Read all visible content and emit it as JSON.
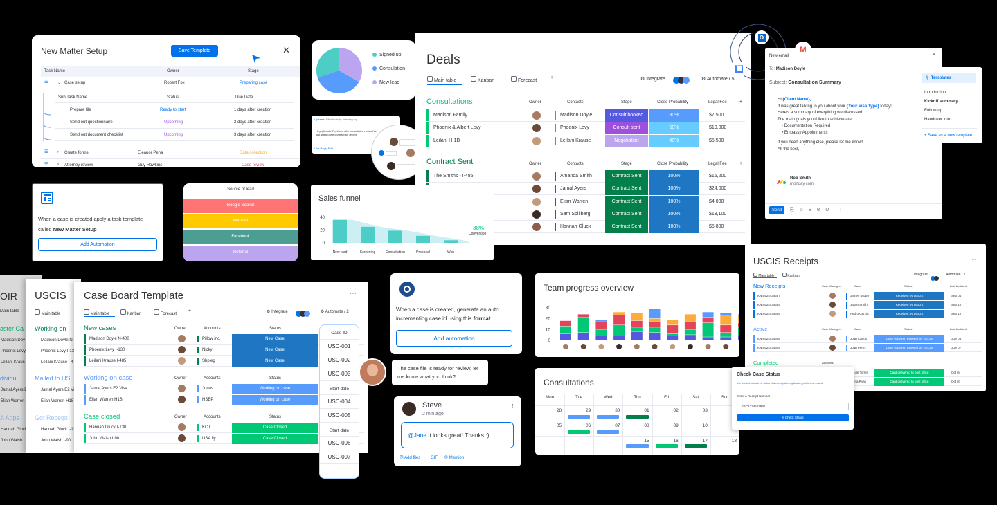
{
  "matter": {
    "title": "New Matter Setup",
    "save_btn": "Save Template",
    "cols": [
      "Task Name",
      "Owner",
      "Stage"
    ],
    "row1": {
      "name": "Case setup",
      "owner": "Robert Fox",
      "stage": "Preparing case"
    },
    "sub_cols": [
      "Sub Task Name",
      "Status",
      "Due Date"
    ],
    "subs": [
      {
        "name": "Prepare file",
        "status": "Ready to start",
        "due": "1 days after creation"
      },
      {
        "name": "Send out questionnaire",
        "status": "Upcoming",
        "due": "2 days after creation"
      },
      {
        "name": "Send out document checklist",
        "status": "Upcoming",
        "due": "3 days after creation"
      }
    ],
    "rows": [
      {
        "name": "Create forms",
        "owner": "Eleanor Pena",
        "stage": "Data collection"
      },
      {
        "name": "Attorney review",
        "owner": "Guy Hawkins",
        "stage": "Case review"
      }
    ]
  },
  "pie": {
    "legend": [
      "Signed up",
      "Consulation",
      "New lead"
    ]
  },
  "update_card": {
    "tabs": [
      "Updates",
      "Files/Activity",
      "Viewing log"
    ],
    "text": "Hey @Leslie Faythe on the consultation team I've just started the contract for review",
    "links": "Like  Reply  Edit"
  },
  "deals": {
    "title": "Deals",
    "views": [
      "Main table",
      "Kanban",
      "Forecast",
      "+"
    ],
    "integrate": "Integrate",
    "automate": "Automate / 5",
    "groups": [
      {
        "name": "Consultations",
        "color": "#00c875",
        "cols": [
          "Owner",
          "Contacts",
          "Stage",
          "Close Probability",
          "Legal Fee"
        ],
        "rows": [
          {
            "name": "Madison Family",
            "contact": "Madison Doyle",
            "stage": "Consult booked",
            "prob": "80%",
            "fee": "$7,500"
          },
          {
            "name": "Phoenix & Albert Levy",
            "contact": "Phoenix Levy",
            "stage": "Consult sent",
            "prob": "60%",
            "fee": "$10,000"
          },
          {
            "name": "Leilani H-1B",
            "contact": "Leilani Krause",
            "stage": "Negotiation",
            "prob": "40%",
            "fee": "$5,500"
          }
        ]
      },
      {
        "name": "Contract Sent",
        "color": "#037f4c",
        "cols": [
          "Owner",
          "Contacts",
          "Stage",
          "Close Probability",
          "Legal Fee"
        ],
        "rows": [
          {
            "name": "The Smiths - I-485",
            "contact": "Amanda Smith",
            "stage": "Contract Sent",
            "prob": "100%",
            "fee": "$15,200"
          },
          {
            "name": "",
            "contact": "Jamal Ayers",
            "stage": "Contract Sent",
            "prob": "100%",
            "fee": "$24,000"
          },
          {
            "name": "",
            "contact": "Elian Warren",
            "stage": "Contract Sent",
            "prob": "100%",
            "fee": "$4,000"
          },
          {
            "name": "",
            "contact": "Sam Spillberg",
            "stage": "Contract Sent",
            "prob": "100%",
            "fee": "$18,100"
          },
          {
            "name": "",
            "contact": "Hannah Gluck",
            "stage": "Contract Sent",
            "prob": "100%",
            "fee": "$5,800"
          }
        ]
      }
    ]
  },
  "email": {
    "header": "New email",
    "to_label": "To:",
    "to": "Madison Doyle",
    "subject_label": "Subject:",
    "subject": "Consultation Summary",
    "greet_prefix": "Hi ",
    "greet_name": "{Client Name},",
    "line1_a": "It was great talking to you about your ",
    "line1_b": "{Your Visa Type}",
    "line1_c": " today!",
    "line2": "Here's a summary of everything we discussed:",
    "line3": "The main goals you'd like to achieve are:",
    "bullets": [
      "Documentation Required",
      "Embassy Appointments"
    ],
    "line4": "If you need anything else, please let me know!",
    "line5": "All the best,",
    "sig_name": "Rob Smith",
    "sig_org": "monday.com",
    "send": "Send"
  },
  "templates": {
    "title": "Templates",
    "items": [
      "Introduction",
      "Kickoff summary",
      "Follow-up",
      "Handover intro"
    ],
    "save": "+ Save as a new template"
  },
  "auto1": {
    "text_a": "When a case is created apply a task template called ",
    "text_b": "New Matter Setup",
    "btn": "Add Automation"
  },
  "source": {
    "title": "Source of lead",
    "items": [
      "Google Search",
      "Website",
      "Facebook",
      "Referral"
    ]
  },
  "funnel": {
    "title": "Sales funnel",
    "conv_pct": "38%",
    "conv_label": "Conversion",
    "chart_data": {
      "type": "bar",
      "categories": [
        "New lead",
        "Screening",
        "Consultation",
        "Proposal",
        "Won"
      ],
      "values": [
        36,
        25,
        19,
        11,
        4
      ],
      "ylim": [
        0,
        40
      ],
      "yticks": [
        0,
        20,
        40
      ]
    }
  },
  "uscis_left": {
    "title1": "OIR",
    "title2": "USCIS",
    "main": "Main table"
  },
  "caseboard": {
    "title": "Case Board Template",
    "views": [
      "Main table",
      "Kanban",
      "Forecast",
      "+"
    ],
    "integrate": "Integrate",
    "automate": "Automate / 2",
    "groups": [
      {
        "name": "New cases",
        "color": "#037f4c",
        "cols": [
          "Owner",
          "Accounts",
          "Status"
        ],
        "rows": [
          {
            "name": "Madison Doyle N-400",
            "acct": "Pillow inc.",
            "status": "New Case"
          },
          {
            "name": "Phoenix Levy I-130",
            "acct": "Nicky",
            "status": "New Case"
          },
          {
            "name": "Leilani Krause I-485",
            "acct": "Shpieg",
            "status": "New Case"
          }
        ]
      },
      {
        "name": "Working on case",
        "color": "#579bfc",
        "cols": [
          "Owner",
          "Accounts",
          "Status"
        ],
        "rows": [
          {
            "name": "Jamal Ayers E2 Visa",
            "acct": "Jonas",
            "status": "Working on case"
          },
          {
            "name": "Elian Warren H1B",
            "acct": "HSBP",
            "status": "Working on case"
          }
        ]
      },
      {
        "name": "Case closed",
        "color": "#00c875",
        "cols": [
          "Owner",
          "Accounts",
          "Status"
        ],
        "rows": [
          {
            "name": "Hannah Gluck I-130",
            "acct": "KCJ",
            "status": "Case Closed"
          },
          {
            "name": "John Walsh I-90",
            "acct": "USA fly",
            "status": "Case Closed"
          }
        ]
      }
    ]
  },
  "back_left": {
    "g1": "aster Ca",
    "r1": [
      "Madison Doy",
      "Phoenix Levy",
      "Leilani Kraus"
    ],
    "g2": "dividu",
    "r2": [
      "Jamal Ayers E",
      "Elian Warren"
    ],
    "g3": "A Appe",
    "r3": [
      "Hannah Gluck",
      "John Walsh"
    ]
  },
  "back_mid": {
    "g1": "Working on",
    "r1": [
      "Madison Doyle N",
      "Phoenix Levy I-13",
      "Leilani Krause I-4"
    ],
    "g2": "Mailed to US",
    "r2": [
      "Jamal Ayers E2 Vi",
      "Elian Warren H18"
    ],
    "g3": "Got Receipt",
    "r3": [
      "Hannah Gluck I-13",
      "John Walsh I-90"
    ]
  },
  "caseid": {
    "h1": "Case ID",
    "ids1": [
      "USC-001",
      "USC-002",
      "USC-003"
    ],
    "h2": "Start date",
    "ids2": [
      "USC-004",
      "USC-005"
    ],
    "h3": "Start date",
    "ids3": [
      "USC-006",
      "USC-007"
    ]
  },
  "auto2": {
    "text_a": "When a case is created, generate an auto incrementing case id using this ",
    "text_b": "format",
    "btn": "Add automation"
  },
  "chat": {
    "text": "The case file is ready for review, let me know what you think?"
  },
  "steve": {
    "name": "Steve",
    "time": "2 min ago",
    "mention": "@Jane",
    "msg": " it looks great!  Thanks :)",
    "actions": [
      "Add files",
      "GIF",
      "@ Mention"
    ]
  },
  "team": {
    "title": "Team progress overview",
    "chart_data": {
      "type": "bar",
      "yticks": [
        0,
        10,
        20,
        30
      ],
      "stacks": [
        [
          6,
          7,
          5,
          0,
          0
        ],
        [
          7,
          14,
          3,
          0,
          0
        ],
        [
          4,
          6,
          7,
          0,
          2
        ],
        [
          4,
          10,
          9,
          3,
          0
        ],
        [
          8,
          4,
          6,
          7,
          0
        ],
        [
          7,
          5,
          5,
          3,
          9
        ],
        [
          4,
          2,
          8,
          5,
          0
        ],
        [
          5,
          5,
          7,
          7,
          0
        ],
        [
          3,
          13,
          5,
          0,
          5
        ],
        [
          3,
          4,
          7,
          9,
          2
        ],
        [
          5,
          7,
          4,
          7,
          1
        ]
      ],
      "colors": [
        "#5559df",
        "#00c875",
        "#e2445c",
        "#fdab3d",
        "#579bfc"
      ]
    }
  },
  "consult": {
    "title": "Consultations",
    "days": [
      "Mon",
      "Tue",
      "Wed",
      "Thu",
      "Fri",
      "Sat",
      "Sun"
    ],
    "week1": [
      "28",
      "29",
      "30",
      "01",
      "02",
      "03",
      "04"
    ],
    "week2": [
      "05",
      "06",
      "07",
      "08",
      "09",
      "10",
      "11"
    ],
    "week3": [
      "",
      "",
      "",
      "15",
      "16",
      "17",
      "18"
    ]
  },
  "receipts": {
    "title": "USCIS Receipts",
    "main": "Main table",
    "kanban": "Kanban",
    "integrate": "Integrate",
    "automate": "Automate / 2",
    "groups": [
      {
        "name": "New Receipts",
        "color": "#0073ea",
        "cols": [
          "Case Managers",
          "Case",
          "Status",
          "Last Updated"
        ],
        "rows": [
          {
            "id": "IOE0924434657",
            "mgr": "James Brown",
            "status": "Received by USCIS",
            "date": "Sep 04"
          },
          {
            "id": "IOE0924434655",
            "mgr": "Jason Smith",
            "status": "Received by USCIS",
            "date": "Sep 10"
          },
          {
            "id": "IOE0924434658",
            "mgr": "Pedro Garcia",
            "status": "Received by USCIS",
            "date": "Sep 12"
          }
        ]
      },
      {
        "name": "Active",
        "color": "#579bfc",
        "cols": [
          "Case Managers",
          "Case",
          "Status",
          "Last Updated"
        ],
        "rows": [
          {
            "id": "IOE0924434608",
            "mgr": "Juan Carlos",
            "status": "Case is being reviewed by USCIS",
            "date": "July 05"
          },
          {
            "id": "IOE0924434609",
            "mgr": "Juan Perez",
            "status": "Case is being reviewed by USCIS",
            "date": "July 07"
          }
        ]
      },
      {
        "name": "Completed",
        "color": "#00c875",
        "cols": [
          "Accounts",
          "",
          "",
          ""
        ],
        "rows": [
          {
            "id": "",
            "mgr": "Nicole Torres",
            "status": "Card delivered to post office",
            "date": "Oct 04"
          },
          {
            "id": "",
            "mgr": "Elena Ryan",
            "status": "Card delivered to post office",
            "date": "Oct 07"
          }
        ]
      }
    ]
  },
  "check": {
    "title": "Check Case Status",
    "desc": "Use this tool to track the status of an immigration application, petition, or request.",
    "label": "Enter a Receipt Number",
    "value": "EAC1234567890",
    "btn": "Check Status"
  }
}
